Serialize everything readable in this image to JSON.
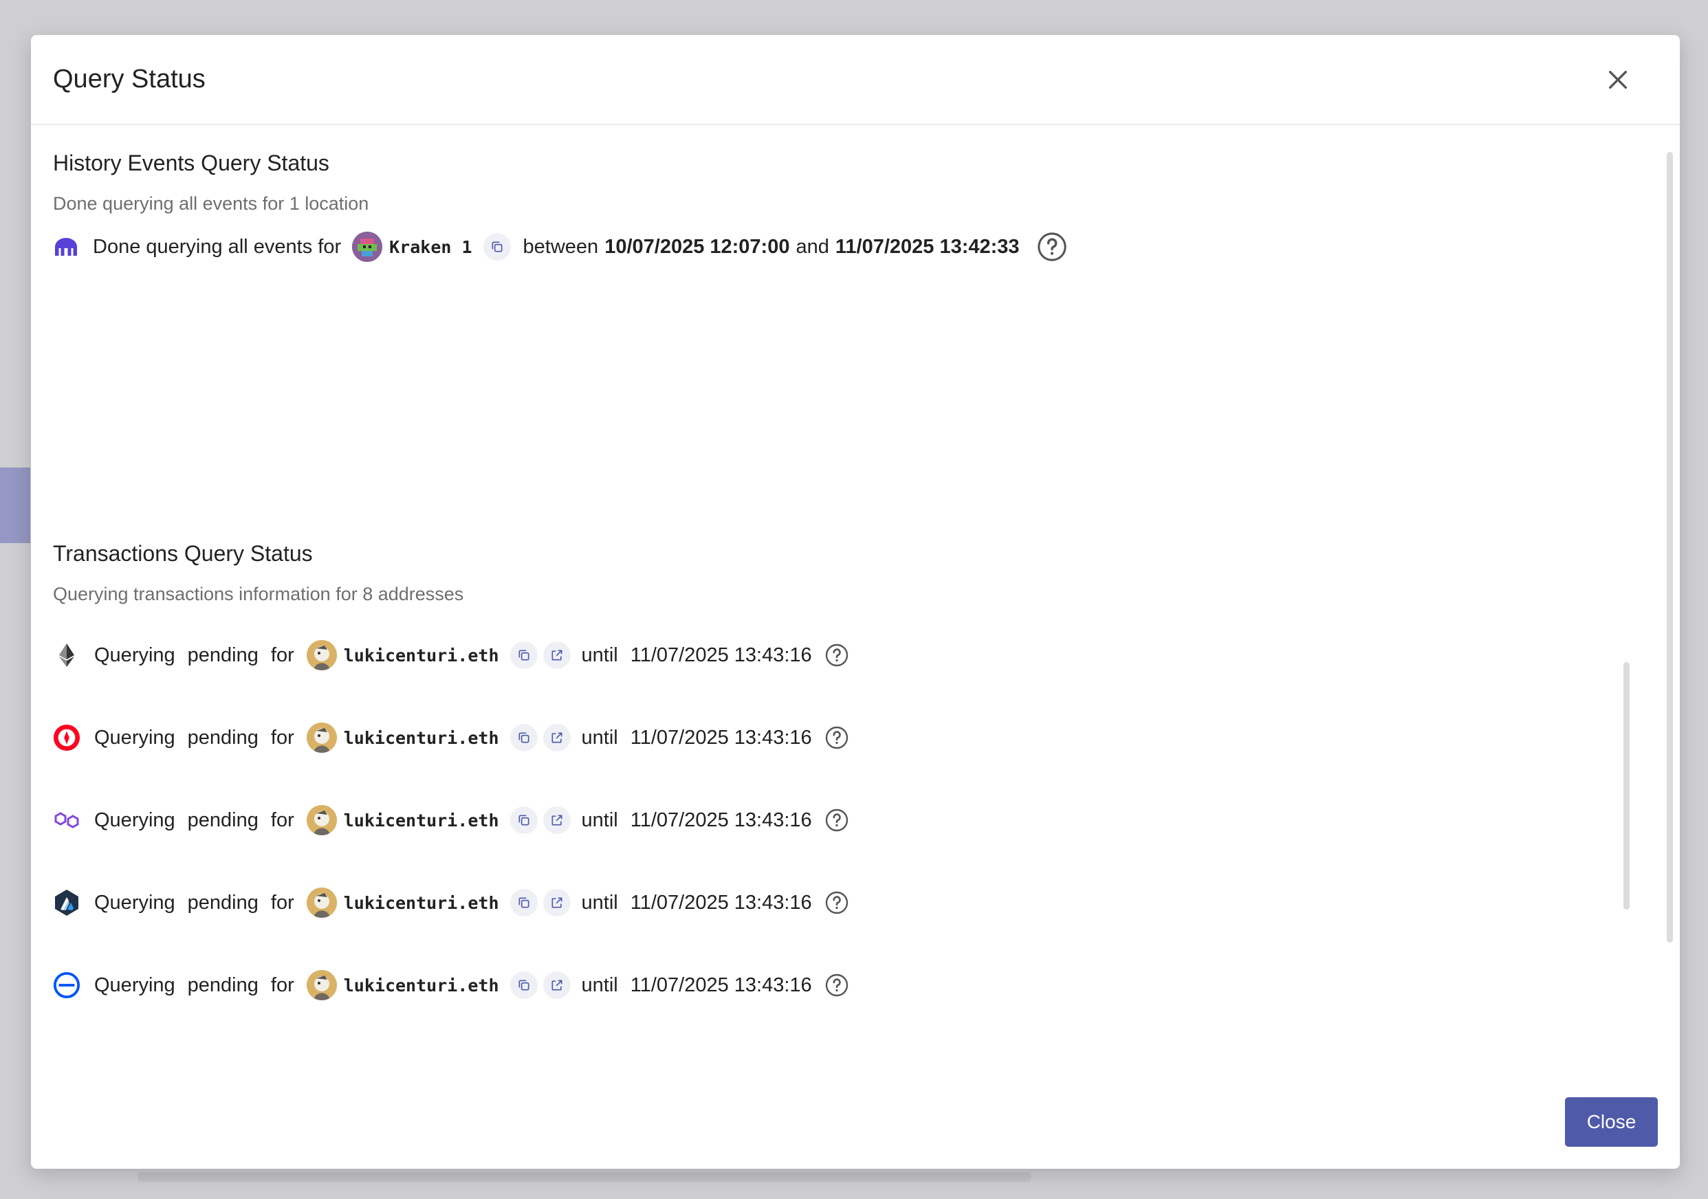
{
  "dialog": {
    "title": "Query Status",
    "close_button": "Close"
  },
  "history": {
    "title": "History Events Query Status",
    "subtitle": "Done querying all events for 1 location",
    "row": {
      "icon": "kraken-logo-icon",
      "prefix": "Done querying all events for",
      "account": "Kraken 1",
      "between": "between",
      "start": "10/07/2025 12:07:00",
      "and": "and",
      "end": "11/07/2025 13:42:33"
    }
  },
  "transactions": {
    "title": "Transactions Query Status",
    "subtitle": "Querying transactions information for 8 addresses",
    "rows": [
      {
        "chain_icon": "ethereum-icon",
        "w1": "Querying",
        "w2": "pending",
        "w3": "for",
        "address": "lukicenturi.eth",
        "until": "until",
        "time": "11/07/2025 13:43:16"
      },
      {
        "chain_icon": "optimism-icon",
        "w1": "Querying",
        "w2": "pending",
        "w3": "for",
        "address": "lukicenturi.eth",
        "until": "until",
        "time": "11/07/2025 13:43:16"
      },
      {
        "chain_icon": "polygon-icon",
        "w1": "Querying",
        "w2": "pending",
        "w3": "for",
        "address": "lukicenturi.eth",
        "until": "until",
        "time": "11/07/2025 13:43:16"
      },
      {
        "chain_icon": "arbitrum-icon",
        "w1": "Querying",
        "w2": "pending",
        "w3": "for",
        "address": "lukicenturi.eth",
        "until": "until",
        "time": "11/07/2025 13:43:16"
      },
      {
        "chain_icon": "base-icon",
        "w1": "Querying",
        "w2": "pending",
        "w3": "for",
        "address": "lukicenturi.eth",
        "until": "until",
        "time": "11/07/2025 13:43:16"
      }
    ]
  },
  "colors": {
    "primary": "#4f5aa8",
    "kraken": "#5741d9",
    "optimism": "#ff0420",
    "polygon": "#8247e5",
    "base": "#0052ff"
  }
}
